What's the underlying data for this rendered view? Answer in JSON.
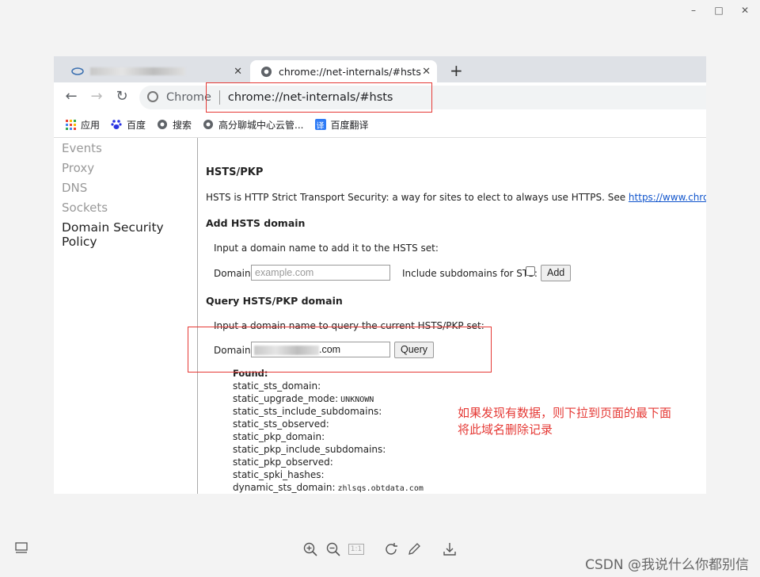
{
  "window": {
    "minimize": "–",
    "maximize": "□",
    "close": "✕"
  },
  "tabs": [
    {
      "label": "",
      "close": "✕"
    },
    {
      "label": "chrome://net-internals/#hsts",
      "close": "✕"
    }
  ],
  "new_tab": "+",
  "nav": {
    "back": "←",
    "forward": "→",
    "reload": "↻"
  },
  "omnibox": {
    "chip": "Chrome",
    "url": "chrome://net-internals/#hsts"
  },
  "bookmarks": [
    {
      "label": "应用",
      "icon": "apps-grid-icon"
    },
    {
      "label": "百度",
      "icon": "baidu-paw-icon"
    },
    {
      "label": "搜索",
      "icon": "globe-icon"
    },
    {
      "label": "高分聊城中心云管...",
      "icon": "globe-icon"
    },
    {
      "label": "百度翻译",
      "icon": "translate-icon"
    }
  ],
  "sidebar": {
    "items": [
      "Events",
      "Proxy",
      "DNS",
      "Sockets",
      "Domain Security Policy"
    ],
    "active_index": 4
  },
  "hsts": {
    "title": "HSTS/PKP",
    "intro": "HSTS is HTTP Strict Transport Security: a way for sites to elect to always use HTTPS. See",
    "intro_link": "https://www.chromium.org/hsts.",
    "add": {
      "heading": "Add HSTS domain",
      "desc": "Input a domain name to add it to the HSTS set:",
      "domain_label": "Domain:",
      "placeholder": "example.com",
      "include_label": "Include subdomains for STS:",
      "add_button": "Add"
    },
    "query": {
      "heading": "Query HSTS/PKP domain",
      "desc": "Input a domain name to query the current HSTS/PKP set:",
      "domain_label": "Domain:",
      "value": ".com",
      "query_button": "Query"
    },
    "result": {
      "found": "Found:",
      "lines": [
        {
          "key": "static_sts_domain:",
          "value": ""
        },
        {
          "key": "static_upgrade_mode:",
          "value": "UNKNOWN"
        },
        {
          "key": "static_sts_include_subdomains:",
          "value": ""
        },
        {
          "key": "static_sts_observed:",
          "value": ""
        },
        {
          "key": "static_pkp_domain:",
          "value": ""
        },
        {
          "key": "static_pkp_include_subdomains:",
          "value": ""
        },
        {
          "key": "static_pkp_observed:",
          "value": ""
        },
        {
          "key": "static_spki_hashes:",
          "value": ""
        },
        {
          "key": "dynamic_sts_domain:",
          "value": "zhlsqs.obtdata.com"
        }
      ]
    }
  },
  "annotation": [
    "如果发现有数据，则下拉到页面的最下面",
    "将此域名删除记录"
  ],
  "viewer_toolbar": {
    "page_indicator": "1:1"
  },
  "watermark": "CSDN @我说什么你都别信",
  "colors": {
    "annotation_red": "#e53935",
    "link_blue": "#1155cc"
  }
}
